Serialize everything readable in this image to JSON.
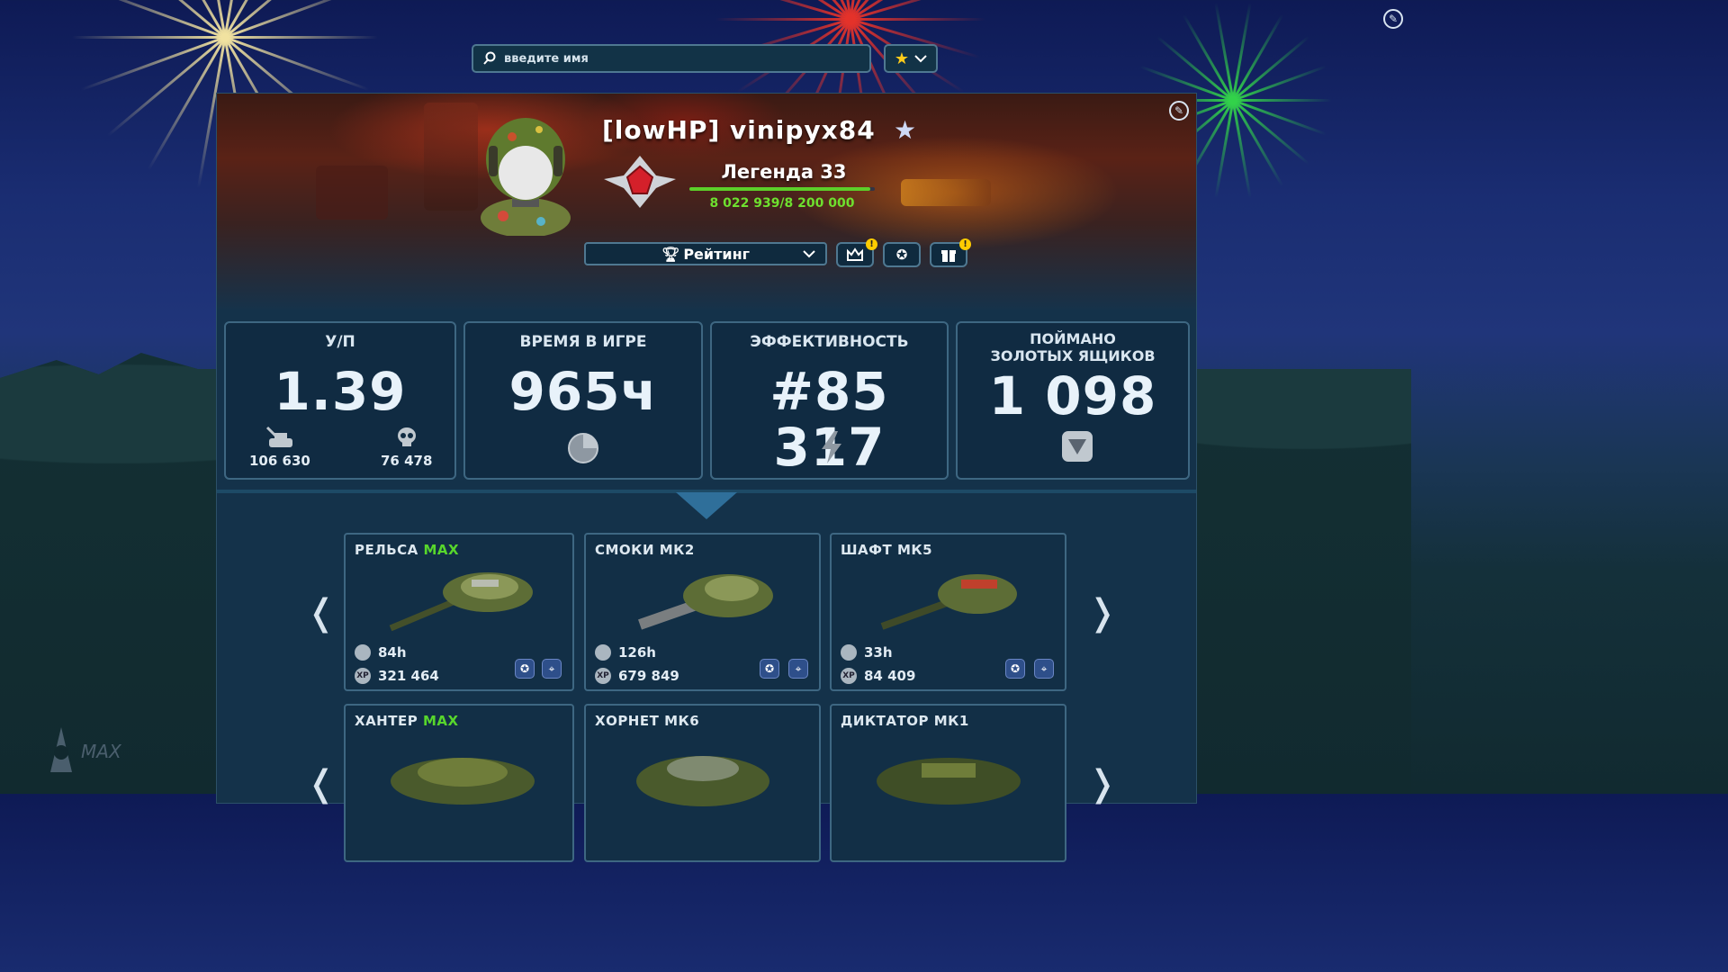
{
  "search": {
    "placeholder": "введите имя"
  },
  "player": {
    "clan_tag": "[lowHP]",
    "name": "vinipyx84",
    "display_name": "[lowHP] vinipyx84",
    "rank_title": "Легенда 33",
    "xp_text": "8 022 939/8 200 000",
    "xp_progress": 0.978
  },
  "controls": {
    "rating_label": "Рейтинг",
    "alert_mark": "!"
  },
  "stats": [
    {
      "title": "У/П",
      "value": "1.39",
      "kills": "106 630",
      "deaths": "76 478"
    },
    {
      "title": "ВРЕМЯ В ИГРЕ",
      "value": "965ч"
    },
    {
      "title": "ЭФФЕКТИВНОСТЬ",
      "value": "#85 317"
    },
    {
      "title_line1": "ПОЙМАНО",
      "title_line2": "ЗОЛОТЫХ ЯЩИКОВ",
      "value": "1 098"
    }
  ],
  "equipment_row1": [
    {
      "name": "РЕЛЬСА",
      "tier": "MAX",
      "hours": "84h",
      "xp": "321 464"
    },
    {
      "name": "СМОКИ МК2",
      "tier": "",
      "hours": "126h",
      "xp": "679 849"
    },
    {
      "name": "ШАФТ МК5",
      "tier": "",
      "hours": "33h",
      "xp": "84 409"
    }
  ],
  "equipment_row2": [
    {
      "name": "ХАНТЕР",
      "tier": "MAX"
    },
    {
      "name": "ХОРНЕТ МК6",
      "tier": ""
    },
    {
      "name": "ДИКТАТОР МК1",
      "tier": ""
    }
  ],
  "icons": {
    "xp_label": "XP",
    "left_arrow": "❬",
    "right_arrow": "❭"
  },
  "colors": {
    "max_green": "#57d62c",
    "xp_green": "#6ee02f",
    "panel": "#14324a",
    "border": "#4f7891"
  }
}
